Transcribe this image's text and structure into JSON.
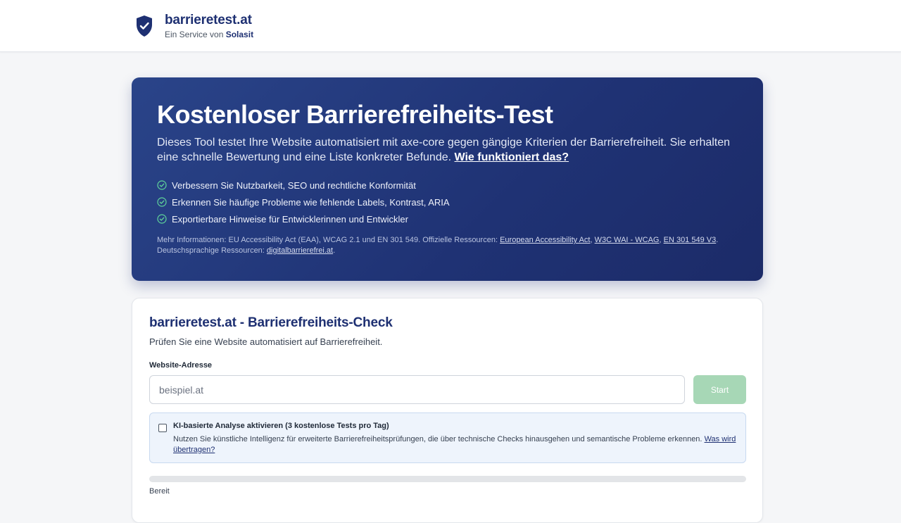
{
  "header": {
    "brand_name": "barrieretest.at",
    "subtitle_prefix": "Ein Service von",
    "subtitle_link": "Solasit",
    "logo_icon": "shield-check-icon"
  },
  "hero": {
    "title": "Kostenloser Barrierefreiheits-Test",
    "description": "Dieses Tool testet Ihre Website automatisiert mit axe-core gegen gängige Kriterien der Barrierefreiheit. Sie erhalten eine schnelle Bewertung und eine Liste konkreter Befunde.",
    "how_link": "Wie funktioniert das?",
    "benefits": [
      "Verbessern Sie Nutzbarkeit, SEO und rechtliche Konformität",
      "Erkennen Sie häufige Probleme wie fehlende Labels, Kontrast, ARIA",
      "Exportierbare Hinweise für Entwicklerinnen und Entwickler"
    ],
    "note_prefix": "Mehr Informationen: EU Accessibility Act (EAA), WCAG 2.1 und EN 301 549. Offizielle Ressourcen:",
    "link_eaa": "European Accessibility Act",
    "link_wcag": "W3C WAI - WCAG",
    "link_en": "EN 301 549 V3",
    "note_german_prefix": "Deutschsprachige Ressourcen:",
    "link_dbf": "digitalbarrierefrei.at"
  },
  "checker": {
    "title": "barrieretest.at - Barrierefreiheits-Check",
    "subtitle": "Prüfen Sie eine Website automatisiert auf Barrierefreiheit.",
    "field_label": "Website-Adresse",
    "input_placeholder": "beispiel.at",
    "input_value": "",
    "start_label": "Start",
    "ai_title": "KI-basierte Analyse aktivieren (3 kostenlose Tests pro Tag)",
    "ai_checked": false,
    "ai_description": "Nutzen Sie künstliche Intelligenz für erweiterte Barrierefreiheitsprüfungen, die über technische Checks hinausgehen und semantische Probleme erkennen.",
    "ai_link": "Was wird übertragen?",
    "progress": 0,
    "status": "Bereit"
  },
  "colors": {
    "brand": "#1e3072",
    "start_button": "#a7d7b6",
    "check_icon": "#5fd59a"
  }
}
